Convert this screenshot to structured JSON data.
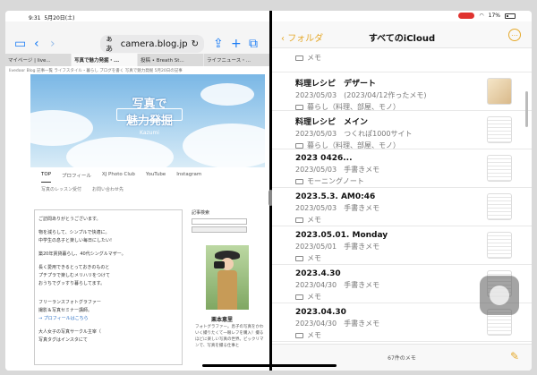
{
  "status": {
    "time": "9:31",
    "date": "5月20日(土)",
    "battery": "17%"
  },
  "safari": {
    "address": "camera.blog.jp",
    "aa": "ぁあ",
    "tabs": [
      "マイページ | live...",
      "写真で魅力発掘・...",
      "投稿 • Breath St...",
      "ライフニュース・..."
    ],
    "bookmarks": "livedoor Blog 記事一覧 ライフスタイル・暮らし ブログを書く 写真で魅力発掘 5月20日の記事"
  },
  "blog": {
    "banner_line1": "写真で",
    "banner_line2": "魅力発掘",
    "banner_sub": "Kazumi",
    "nav": [
      "TOP",
      "プロフィール",
      "XJ Photo Club",
      "YouTube",
      "Instagram"
    ],
    "nav2": [
      "写真のレッスン受付",
      "お問い合わせ先"
    ],
    "post_lines": [
      "ご訪問ありがとうございます。",
      "物を減らして、シンプルで快適に。",
      "中学生の息子と楽しい毎日にしたい!",
      "築20年賃貸暮らし、40代シングルマザー。",
      "長く愛用できるとっておきのものと",
      "プチプラで楽しむメリハリをつけて",
      "おうちでグッすり暮らしてます。",
      "フリーランスフォトグラファー",
      "撮影＆写真セミナー講師。",
      "→ プロフィールはこちら",
      "大人女子の写真サークル主宰（",
      "写真タグはインスタにて"
    ],
    "side_label": "記事検索",
    "side_name": "栗本恵里",
    "side_bio": "フォトグラファー。息子の写真をかわいく撮りたくて一眼レフを購入！撮るほどに楽しい写真の世界。ビックリマンで、写真を撮る仕事と"
  },
  "notes": {
    "back_label": "フォルダ",
    "title": "すべてのiCloud",
    "more": "…",
    "items": [
      {
        "title": "",
        "meta": "",
        "folder": "メモ"
      },
      {
        "title": "料理レシピ　デザート",
        "meta": "2023/05/03　(2023/04/12作ったメモ)",
        "folder": "暮らし（料理、部屋、モノ）"
      },
      {
        "title": "料理レシピ　メイン",
        "meta": "2023/05/03　つくれぽ1000サイト",
        "folder": "暮らし（料理、部屋、モノ）"
      },
      {
        "title": "2023 0426...",
        "meta": "2023/05/03　手書きメモ",
        "folder": "モーニングノート"
      },
      {
        "title": "2023.5.3. AM0:46",
        "meta": "2023/05/03　手書きメモ",
        "folder": "メモ"
      },
      {
        "title": "2023.05.01. Monday",
        "meta": "2023/05/01　手書きメモ",
        "folder": "メモ"
      },
      {
        "title": "2023.4.30",
        "meta": "2023/04/30　手書きメモ",
        "folder": "メモ"
      },
      {
        "title": "2023.04.30",
        "meta": "2023/04/30　手書きメモ",
        "folder": "メモ"
      }
    ],
    "count": "67件のメモ"
  }
}
